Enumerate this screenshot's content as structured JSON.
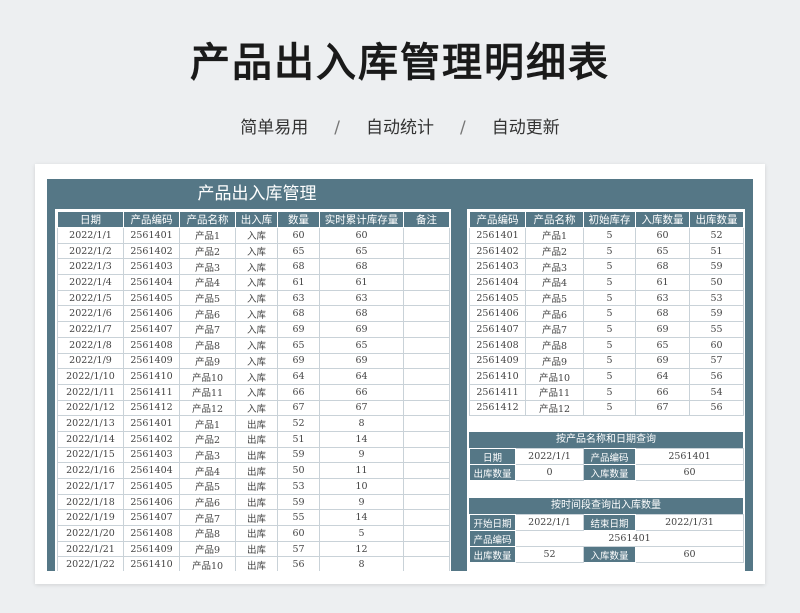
{
  "page": {
    "title": "产品出入库管理明细表",
    "subtitle": [
      "简单易用",
      "自动统计",
      "自动更新"
    ],
    "separator": "/"
  },
  "sheet": {
    "title": "产品出入库管理"
  },
  "ledger": {
    "headers": [
      "日期",
      "产品编码",
      "产品名称",
      "出入库",
      "数量",
      "实时累计库存量",
      "备注"
    ],
    "rows": [
      [
        "2022/1/1",
        "2561401",
        "产品1",
        "入库",
        "60",
        "60",
        ""
      ],
      [
        "2022/1/2",
        "2561402",
        "产品2",
        "入库",
        "65",
        "65",
        ""
      ],
      [
        "2022/1/3",
        "2561403",
        "产品3",
        "入库",
        "68",
        "68",
        ""
      ],
      [
        "2022/1/4",
        "2561404",
        "产品4",
        "入库",
        "61",
        "61",
        ""
      ],
      [
        "2022/1/5",
        "2561405",
        "产品5",
        "入库",
        "63",
        "63",
        ""
      ],
      [
        "2022/1/6",
        "2561406",
        "产品6",
        "入库",
        "68",
        "68",
        ""
      ],
      [
        "2022/1/7",
        "2561407",
        "产品7",
        "入库",
        "69",
        "69",
        ""
      ],
      [
        "2022/1/8",
        "2561408",
        "产品8",
        "入库",
        "65",
        "65",
        ""
      ],
      [
        "2022/1/9",
        "2561409",
        "产品9",
        "入库",
        "69",
        "69",
        ""
      ],
      [
        "2022/1/10",
        "2561410",
        "产品10",
        "入库",
        "64",
        "64",
        ""
      ],
      [
        "2022/1/11",
        "2561411",
        "产品11",
        "入库",
        "66",
        "66",
        ""
      ],
      [
        "2022/1/12",
        "2561412",
        "产品12",
        "入库",
        "67",
        "67",
        ""
      ],
      [
        "2022/1/13",
        "2561401",
        "产品1",
        "出库",
        "52",
        "8",
        ""
      ],
      [
        "2022/1/14",
        "2561402",
        "产品2",
        "出库",
        "51",
        "14",
        ""
      ],
      [
        "2022/1/15",
        "2561403",
        "产品3",
        "出库",
        "59",
        "9",
        ""
      ],
      [
        "2022/1/16",
        "2561404",
        "产品4",
        "出库",
        "50",
        "11",
        ""
      ],
      [
        "2022/1/17",
        "2561405",
        "产品5",
        "出库",
        "53",
        "10",
        ""
      ],
      [
        "2022/1/18",
        "2561406",
        "产品6",
        "出库",
        "59",
        "9",
        ""
      ],
      [
        "2022/1/19",
        "2561407",
        "产品7",
        "出库",
        "55",
        "14",
        ""
      ],
      [
        "2022/1/20",
        "2561408",
        "产品8",
        "出库",
        "60",
        "5",
        ""
      ],
      [
        "2022/1/21",
        "2561409",
        "产品9",
        "出库",
        "57",
        "12",
        ""
      ],
      [
        "2022/1/22",
        "2561410",
        "产品10",
        "出库",
        "56",
        "8",
        ""
      ]
    ]
  },
  "summary": {
    "headers": [
      "产品编码",
      "产品名称",
      "初始库存",
      "入库数量",
      "出库数量"
    ],
    "rows": [
      [
        "2561401",
        "产品1",
        "5",
        "60",
        "52"
      ],
      [
        "2561402",
        "产品2",
        "5",
        "65",
        "51"
      ],
      [
        "2561403",
        "产品3",
        "5",
        "68",
        "59"
      ],
      [
        "2561404",
        "产品4",
        "5",
        "61",
        "50"
      ],
      [
        "2561405",
        "产品5",
        "5",
        "63",
        "53"
      ],
      [
        "2561406",
        "产品6",
        "5",
        "68",
        "59"
      ],
      [
        "2561407",
        "产品7",
        "5",
        "69",
        "55"
      ],
      [
        "2561408",
        "产品8",
        "5",
        "65",
        "60"
      ],
      [
        "2561409",
        "产品9",
        "5",
        "69",
        "57"
      ],
      [
        "2561410",
        "产品10",
        "5",
        "64",
        "56"
      ],
      [
        "2561411",
        "产品11",
        "5",
        "66",
        "54"
      ],
      [
        "2561412",
        "产品12",
        "5",
        "67",
        "56"
      ]
    ]
  },
  "query_by_name_date": {
    "title": "按产品名称和日期查询",
    "date_label": "日期",
    "date_value": "2022/1/1",
    "code_label": "产品编码",
    "code_value": "2561401",
    "out_label": "出库数量",
    "out_value": "0",
    "in_label": "入库数量",
    "in_value": "60"
  },
  "query_by_period": {
    "title": "按时间段查询出入库数量",
    "start_label": "开始日期",
    "start_value": "2022/1/1",
    "end_label": "结束日期",
    "end_value": "2022/1/31",
    "code_label": "产品编码",
    "code_value": "2561401",
    "out_label": "出库数量",
    "out_value": "52",
    "in_label": "入库数量",
    "in_value": "60"
  },
  "colors": {
    "accent": "#557786",
    "background": "#edeff1",
    "grid": "#c9d2d8"
  }
}
